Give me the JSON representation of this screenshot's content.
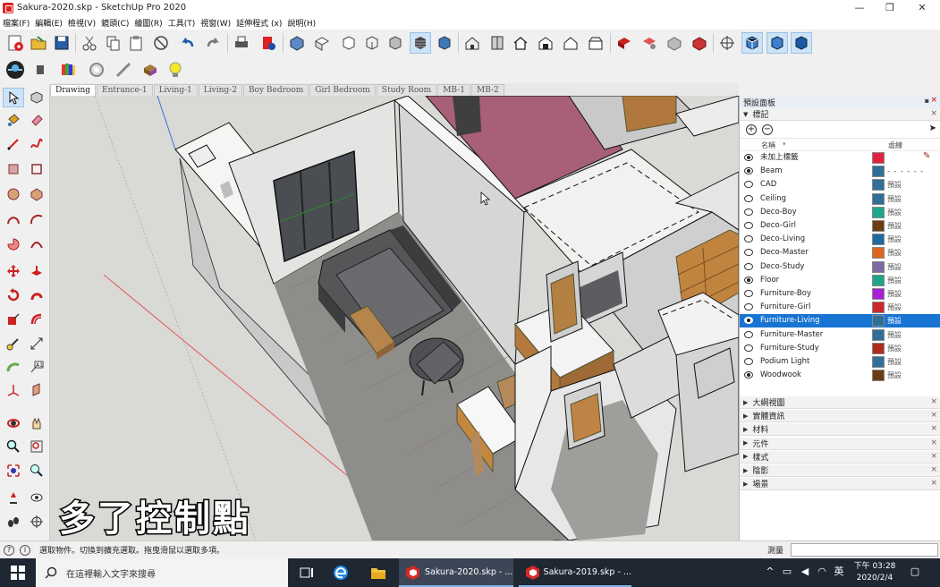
{
  "window": {
    "title": "Sakura-2020.skp - SketchUp Pro 2020",
    "controls": [
      "—",
      "❐",
      "✕"
    ]
  },
  "menu": [
    "檔案(F)",
    "編輯(E)",
    "檢視(V)",
    "鏡頭(C)",
    "繪圖(R)",
    "工具(T)",
    "視窗(W)",
    "延伸程式 (x)",
    "說明(H)"
  ],
  "scene_tabs": [
    "Drawing",
    "Entrance-1",
    "Living-1",
    "Living-2",
    "Boy Bedroom",
    "Girl Bedroom",
    "Study Room",
    "MB-1",
    "MB-2"
  ],
  "active_scene": "Drawing",
  "caption": "多了控制點",
  "tray": {
    "title": "預設面板",
    "tags_panel": {
      "title": "標記",
      "col_name": "名稱",
      "col_dash": "虛線",
      "layers": [
        {
          "name": "未加上標籤",
          "visible": true,
          "color": "#e2233e",
          "dash": "",
          "edit": true
        },
        {
          "name": "Beam",
          "visible": true,
          "color": "#2f6f98",
          "dash": "- - - - - -"
        },
        {
          "name": "CAD",
          "visible": false,
          "color": "#2f6f98",
          "dash": "預設"
        },
        {
          "name": "Ceiling",
          "visible": false,
          "color": "#2f6f98",
          "dash": "預設"
        },
        {
          "name": "Deco-Boy",
          "visible": false,
          "color": "#1ea889",
          "dash": "預設"
        },
        {
          "name": "Deco-Girl",
          "visible": false,
          "color": "#6b3d12",
          "dash": "預設"
        },
        {
          "name": "Deco-Living",
          "visible": false,
          "color": "#1f6aa0",
          "dash": "預設"
        },
        {
          "name": "Deco-Master",
          "visible": false,
          "color": "#e0661f",
          "dash": "預設"
        },
        {
          "name": "Deco-Study",
          "visible": false,
          "color": "#7b6aa3",
          "dash": "預設"
        },
        {
          "name": "Floor",
          "visible": true,
          "color": "#21a387",
          "dash": "預設"
        },
        {
          "name": "Furniture-Boy",
          "visible": false,
          "color": "#a81fd6",
          "dash": "預設"
        },
        {
          "name": "Furniture-Girl",
          "visible": false,
          "color": "#c9282a",
          "dash": "預設"
        },
        {
          "name": "Furniture-Living",
          "visible": true,
          "color": "#2f6f98",
          "dash": "預設",
          "selected": true
        },
        {
          "name": "Furniture-Master",
          "visible": false,
          "color": "#2f6f98",
          "dash": "預設"
        },
        {
          "name": "Furniture-Study",
          "visible": false,
          "color": "#b02a1f",
          "dash": "預設"
        },
        {
          "name": "Podium Light",
          "visible": false,
          "color": "#2f6f98",
          "dash": "預設"
        },
        {
          "name": "Woodwook",
          "visible": true,
          "color": "#6b3d12",
          "dash": "預設"
        }
      ]
    },
    "collapsed_panels": [
      "大綱視圖",
      "實體資訊",
      "材料",
      "元件",
      "樣式",
      "陰影",
      "場景"
    ]
  },
  "status": {
    "hint": "選取物件。切換到擴充選取。拖曳滑鼠以選取多項。",
    "measure_label": "測量",
    "measure_value": ""
  },
  "taskbar": {
    "search_placeholder": "在這裡輸入文字來搜尋",
    "tasks": [
      "Sakura-2020.skp - ...",
      "Sakura-2019.skp - ..."
    ],
    "ime": "英",
    "time": "下午 03:28",
    "date": "2020/2/4"
  }
}
